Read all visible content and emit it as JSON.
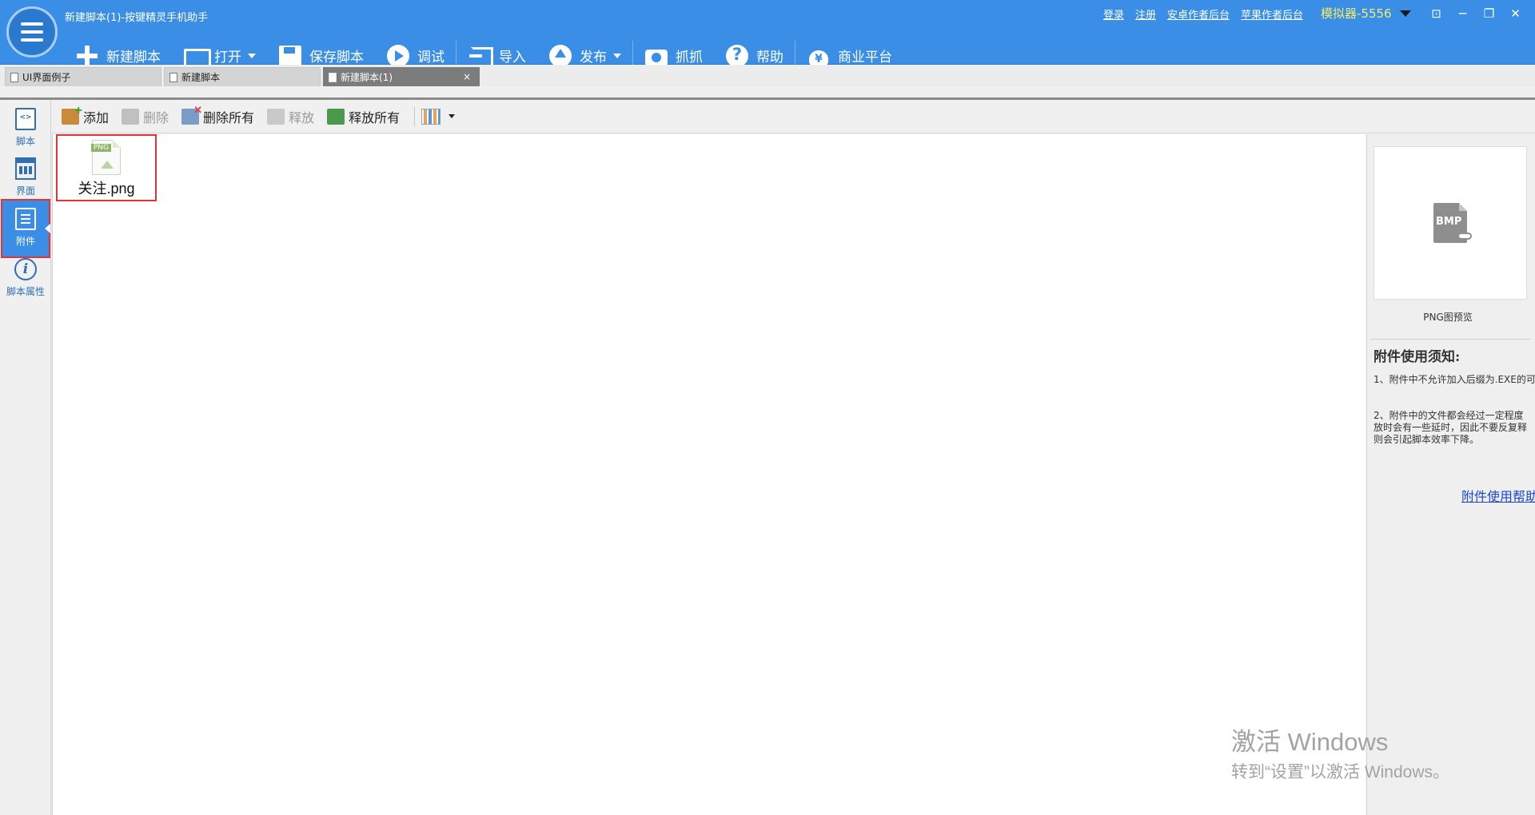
{
  "window": {
    "title": "新建脚本(1)-按键精灵手机助手",
    "top_links": [
      "登录",
      "注册",
      "安卓作者后台",
      "苹果作者后台"
    ],
    "simulator": "模拟器-5556",
    "controls": [
      "⊡",
      "─",
      "❐",
      "✕"
    ]
  },
  "toolbar": [
    {
      "label": "新建脚本",
      "icon": "plus-icon"
    },
    {
      "label": "打开",
      "icon": "folder-icon",
      "dropdown": true
    },
    {
      "label": "保存脚本",
      "icon": "save-icon"
    },
    {
      "label": "调试",
      "icon": "play-icon"
    },
    {
      "label": "导入",
      "icon": "import-icon"
    },
    {
      "label": "发布",
      "icon": "publish-icon",
      "dropdown": true
    },
    {
      "label": "抓抓",
      "icon": "camera-icon"
    },
    {
      "label": "帮助",
      "icon": "help-icon"
    },
    {
      "label": "商业平台",
      "icon": "money-bag-icon"
    }
  ],
  "tabs": [
    {
      "label": "UI界面例子",
      "active": false
    },
    {
      "label": "新建脚本",
      "active": false
    },
    {
      "label": "新建脚本(1)",
      "active": true,
      "close": "×"
    }
  ],
  "sidebar": [
    {
      "label": "脚本",
      "icon": "script-doc-icon",
      "active": false
    },
    {
      "label": "界面",
      "icon": "layout-grid-icon",
      "active": false
    },
    {
      "label": "附件",
      "icon": "attachment-icon",
      "active": true
    },
    {
      "label": "脚本属性",
      "icon": "info-icon",
      "active": false
    }
  ],
  "attachment_toolbar": {
    "add": "添加",
    "delete": "删除",
    "delete_all": "删除所有",
    "release": "释放",
    "release_all": "释放所有"
  },
  "files": [
    {
      "name": "关注.png",
      "type_tag": "PNG",
      "selected": true
    }
  ],
  "right_panel": {
    "preview_icon_text": "BMP",
    "preview_label": "PNG图预览",
    "notice_title": "附件使用须知:",
    "notes": [
      "1、附件中不允许加入后缀为.EXE的可",
      "2、附件中的文件都会经过一定程度",
      "放时会有一些延时，因此不要反复释",
      "则会引起脚本效率下降。"
    ],
    "help_link": "附件使用帮助"
  },
  "watermark": {
    "line1": "激活 Windows",
    "line2": "转到“设置”以激活 Windows。"
  },
  "colors": {
    "header_blue": "#3a8ee6",
    "simulator_text": "#f4ef6a",
    "selection_red": "#e53333",
    "link_blue": "#1a46d6"
  }
}
